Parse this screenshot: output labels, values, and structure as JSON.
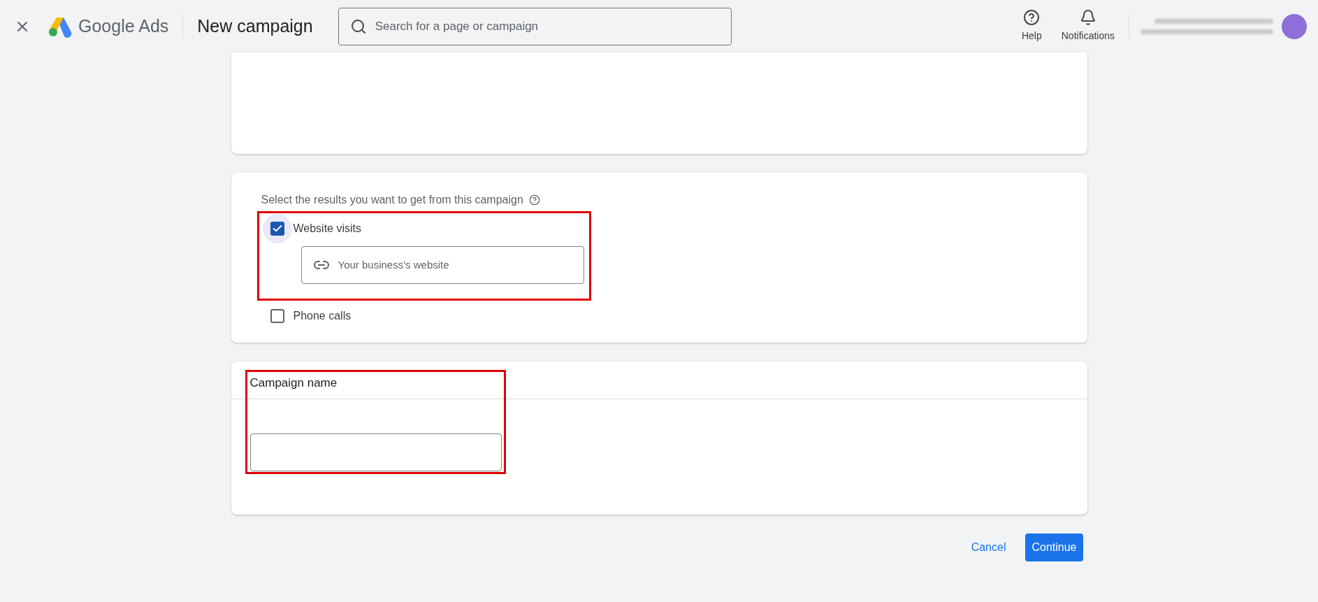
{
  "header": {
    "product_word_1": "Google",
    "product_word_2": "Ads",
    "title": "New campaign",
    "search": {
      "placeholder": "Search for a page or campaign"
    },
    "actions": [
      {
        "kind": "help",
        "label": "Help"
      },
      {
        "kind": "notifications",
        "label": "Notifications"
      }
    ]
  },
  "results_card": {
    "prompt": "Select the results you want to get from this campaign",
    "options": [
      {
        "label": "Website visits",
        "checked": true,
        "highlighted": true,
        "field": {
          "placeholder": "Your business's website"
        }
      },
      {
        "label": "Phone calls",
        "checked": false,
        "highlighted": false
      }
    ]
  },
  "name_card": {
    "title": "Campaign name",
    "highlighted": true
  },
  "footer": {
    "cancel": "Cancel",
    "continue": "Continue"
  }
}
